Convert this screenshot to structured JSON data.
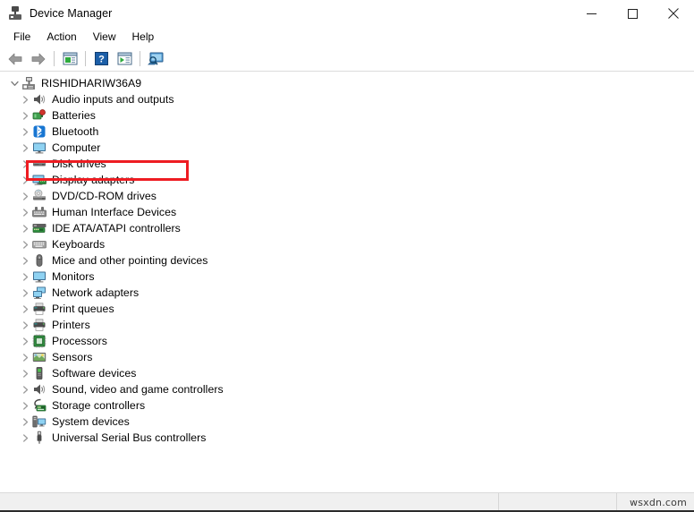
{
  "window": {
    "title": "Device Manager",
    "icon": "device-manager-icon",
    "controls": {
      "minimize": "minimize-icon",
      "maximize": "maximize-icon",
      "close": "close-icon"
    }
  },
  "menubar": {
    "items": [
      {
        "label": "File"
      },
      {
        "label": "Action"
      },
      {
        "label": "View"
      },
      {
        "label": "Help"
      }
    ]
  },
  "toolbar": {
    "buttons": [
      {
        "name": "back-button",
        "icon": "back-arrow-icon"
      },
      {
        "name": "forward-button",
        "icon": "forward-arrow-icon"
      },
      {
        "separator_after": true
      },
      {
        "name": "properties-button",
        "icon": "properties-icon"
      },
      {
        "separator_after": true
      },
      {
        "name": "help-button",
        "icon": "help-question-icon"
      },
      {
        "name": "update-driver-button",
        "icon": "update-driver-icon"
      },
      {
        "separator_after": true
      },
      {
        "name": "scan-hardware-changes-button",
        "icon": "scan-hardware-icon"
      }
    ]
  },
  "tree": {
    "root": {
      "label": "RISHIDHARIW36A9",
      "icon": "computer-root-icon",
      "expanded": true
    },
    "nodes": [
      {
        "label": "Audio inputs and outputs",
        "icon": "speaker-icon",
        "highlighted": true
      },
      {
        "label": "Batteries",
        "icon": "battery-icon",
        "highlighted": false
      },
      {
        "label": "Bluetooth",
        "icon": "bluetooth-icon",
        "highlighted": false
      },
      {
        "label": "Computer",
        "icon": "monitor-icon",
        "highlighted": false
      },
      {
        "label": "Disk drives",
        "icon": "disk-drive-icon",
        "highlighted": false
      },
      {
        "label": "Display adapters",
        "icon": "display-adapter-icon",
        "highlighted": false
      },
      {
        "label": "DVD/CD-ROM drives",
        "icon": "dvd-drive-icon",
        "highlighted": false
      },
      {
        "label": "Human Interface Devices",
        "icon": "hid-icon",
        "highlighted": false
      },
      {
        "label": "IDE ATA/ATAPI controllers",
        "icon": "ide-controller-icon",
        "highlighted": false
      },
      {
        "label": "Keyboards",
        "icon": "keyboard-icon",
        "highlighted": false
      },
      {
        "label": "Mice and other pointing devices",
        "icon": "mouse-icon",
        "highlighted": false
      },
      {
        "label": "Monitors",
        "icon": "monitor-icon",
        "highlighted": false
      },
      {
        "label": "Network adapters",
        "icon": "network-adapter-icon",
        "highlighted": false
      },
      {
        "label": "Print queues",
        "icon": "printer-icon",
        "highlighted": false
      },
      {
        "label": "Printers",
        "icon": "printer-icon",
        "highlighted": false
      },
      {
        "label": "Processors",
        "icon": "processor-icon",
        "highlighted": false
      },
      {
        "label": "Sensors",
        "icon": "sensor-icon",
        "highlighted": false
      },
      {
        "label": "Software devices",
        "icon": "software-device-icon",
        "highlighted": false
      },
      {
        "label": "Sound, video and game controllers",
        "icon": "speaker-icon",
        "highlighted": false
      },
      {
        "label": "Storage controllers",
        "icon": "storage-controller-icon",
        "highlighted": false
      },
      {
        "label": "System devices",
        "icon": "system-device-icon",
        "highlighted": false
      },
      {
        "label": "Universal Serial Bus controllers",
        "icon": "usb-icon",
        "highlighted": false
      }
    ]
  },
  "annotation": {
    "highlight_color": "#ee1c22",
    "target": "Audio inputs and outputs"
  },
  "statusbar": {
    "pane1": "",
    "pane2": "",
    "watermark": "wsxdn.com"
  }
}
